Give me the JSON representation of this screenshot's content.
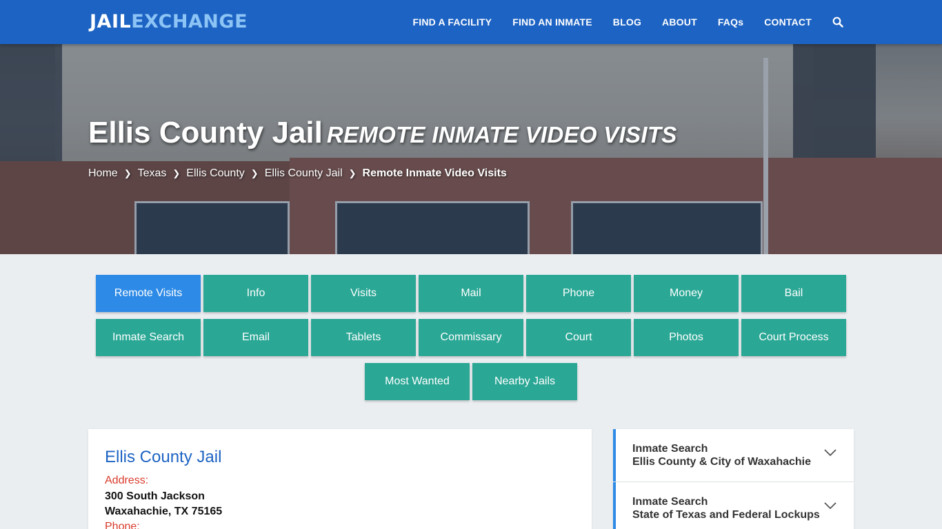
{
  "header": {
    "logo_part1": "JAIL",
    "logo_part2": "EXCHANGE",
    "nav": [
      "FIND A FACILITY",
      "FIND AN INMATE",
      "BLOG",
      "ABOUT",
      "FAQs",
      "CONTACT"
    ],
    "search_icon": "search-icon"
  },
  "hero": {
    "title": "Ellis County Jail",
    "subtitle": "REMOTE INMATE VIDEO VISITS",
    "breadcrumb": [
      "Home",
      "Texas",
      "Ellis County",
      "Ellis County Jail",
      "Remote Inmate Video Visits"
    ]
  },
  "buttons": {
    "row1": [
      "Remote Visits",
      "Info",
      "Visits",
      "Mail",
      "Phone",
      "Money",
      "Bail"
    ],
    "row2": [
      "Inmate Search",
      "Email",
      "Tablets",
      "Commissary",
      "Court",
      "Photos",
      "Court Process"
    ],
    "row3": [
      "Most Wanted",
      "Nearby Jails"
    ],
    "active": "Remote Visits"
  },
  "card": {
    "title": "Ellis County Jail",
    "address_label": "Address:",
    "address_line1": "300 South Jackson",
    "address_line2": "Waxahachie, TX 75165",
    "phone_label": "Phone:"
  },
  "sidebar": [
    {
      "title": "Inmate Search",
      "subtitle": "Ellis County & City of Waxahachie"
    },
    {
      "title": "Inmate Search",
      "subtitle": "State of Texas and Federal Lockups"
    }
  ],
  "colors": {
    "header_blue": "#1d63c3",
    "logo_accent": "#8cc4f5",
    "button_teal": "#2aa795",
    "button_active": "#2d8ae6",
    "label_red": "#d93a2b"
  }
}
